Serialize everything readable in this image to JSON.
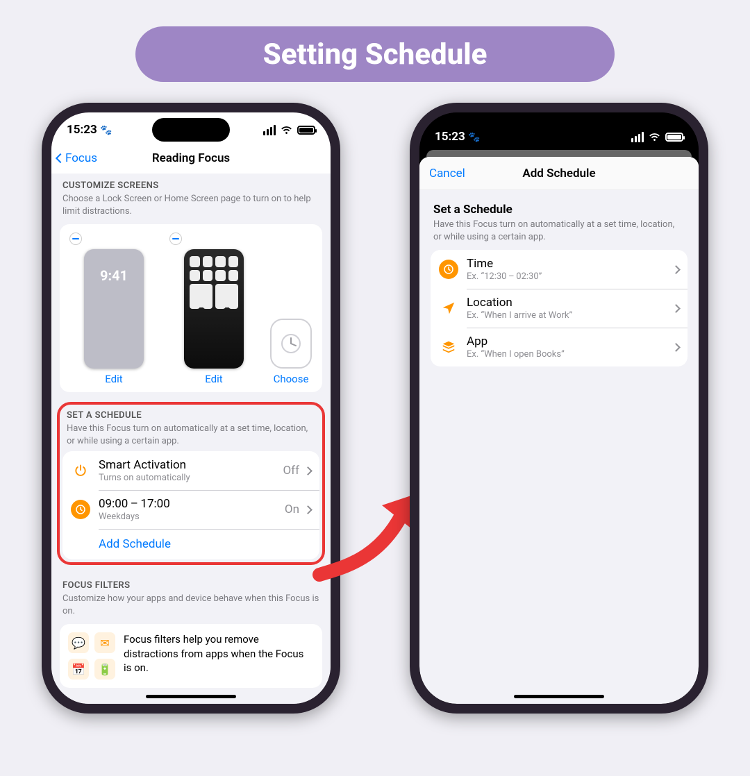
{
  "badge": "Setting Schedule",
  "status": {
    "time": "15:23"
  },
  "left": {
    "back": "Focus",
    "title": "Reading Focus",
    "custom": {
      "header": "CUSTOMIZE SCREENS",
      "desc": "Choose a Lock Screen or Home Screen page to turn on to help limit distractions.",
      "lockTime": "9:41",
      "edit": "Edit",
      "choose": "Choose"
    },
    "schedule": {
      "header": "SET A SCHEDULE",
      "desc": "Have this Focus turn on automatically at a set time, location, or while using a certain app.",
      "rows": [
        {
          "title": "Smart Activation",
          "sub": "Turns on automatically",
          "val": "Off"
        },
        {
          "title": "09:00 – 17:00",
          "sub": "Weekdays",
          "val": "On"
        }
      ],
      "add": "Add Schedule"
    },
    "filters": {
      "header": "FOCUS FILTERS",
      "desc": "Customize how your apps and device behave when this Focus is on.",
      "text": "Focus filters help you remove distractions from apps when the Focus is on."
    }
  },
  "right": {
    "cancel": "Cancel",
    "title": "Add Schedule",
    "header": "Set a Schedule",
    "desc": "Have this Focus turn on automatically at a set time, location, or while using a certain app.",
    "rows": [
      {
        "title": "Time",
        "sub": "Ex. “12:30 – 02:30”"
      },
      {
        "title": "Location",
        "sub": "Ex. “When I arrive at Work”"
      },
      {
        "title": "App",
        "sub": "Ex. “When I open Books”"
      }
    ]
  }
}
